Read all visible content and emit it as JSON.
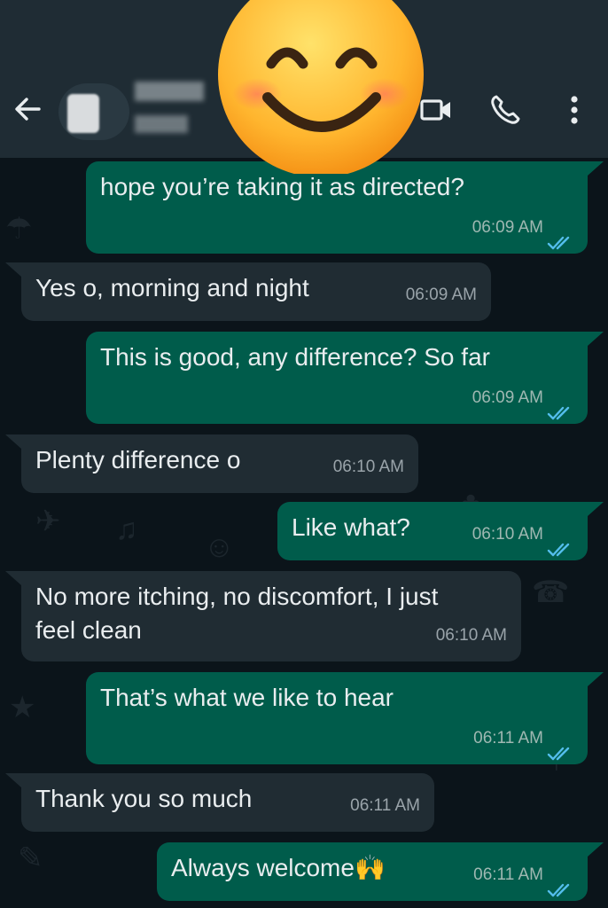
{
  "header": {
    "back_icon": "arrow-left-icon",
    "video_icon": "video-camera-icon",
    "call_icon": "phone-icon",
    "menu_icon": "vertical-dots-icon",
    "overlay_emoji": "smiling-face-icon"
  },
  "colors": {
    "header_bg": "#1f2c34",
    "chat_bg": "#0b141a",
    "outgoing_bubble": "#005c4b",
    "incoming_bubble": "#202c33",
    "read_tick": "#53bdeb"
  },
  "messages": [
    {
      "dir": "out",
      "lines": [
        "hope you’re taking it as directed?"
      ],
      "time": "06:09 AM"
    },
    {
      "dir": "in",
      "lines": [
        "Yes o, morning and night"
      ],
      "time": "06:09 AM"
    },
    {
      "dir": "out",
      "lines": [
        "This is good, any difference? So far"
      ],
      "time": "06:09 AM"
    },
    {
      "dir": "in",
      "lines": [
        "Plenty difference o"
      ],
      "time": "06:10 AM"
    },
    {
      "dir": "out",
      "lines": [
        "Like what?"
      ],
      "time": "06:10 AM"
    },
    {
      "dir": "in",
      "lines": [
        "No more itching, no discomfort, I just",
        "feel clean"
      ],
      "time": "06:10 AM"
    },
    {
      "dir": "out",
      "lines": [
        "That’s what we like to hear"
      ],
      "time": "06:11 AM"
    },
    {
      "dir": "in",
      "lines": [
        "Thank you so much"
      ],
      "time": "06:11 AM"
    },
    {
      "dir": "out",
      "lines": [
        "Always welcome🙌"
      ],
      "time": "06:11 AM"
    }
  ]
}
